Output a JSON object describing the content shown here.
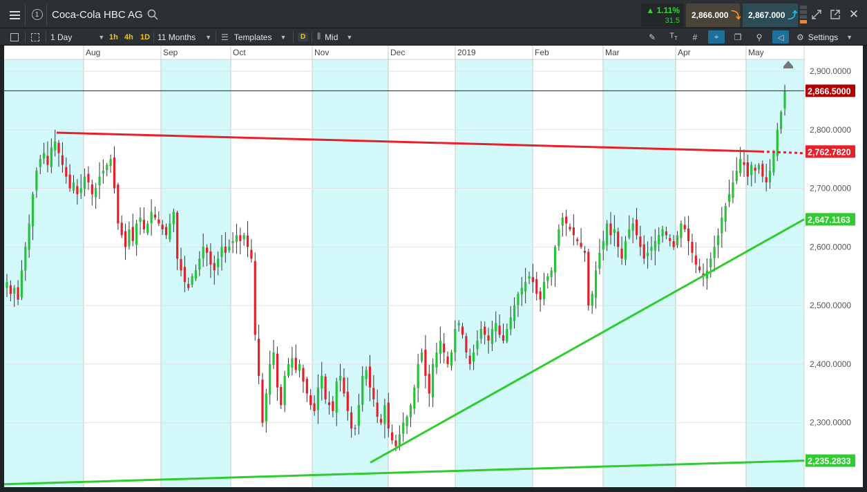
{
  "header": {
    "instrument_title": "Coca-Cola HBC AG",
    "change_pct": "▲ 1.11%",
    "change_abs": "31.5",
    "sell_price": "2,866.000",
    "buy_price": "2,867.000",
    "colors": {
      "up": "#38d13c",
      "sell_bg": "#4a4338",
      "buy_bg": "#2e4c58"
    }
  },
  "toolbar": {
    "interval_label": "1 Day",
    "quick_intervals": [
      "1h",
      "4h",
      "1D"
    ],
    "range_label": "11 Months",
    "templates_label": "Templates",
    "d_badge": "D",
    "price_type_label": "Mid",
    "settings_label": "Settings"
  },
  "chart_data": {
    "type": "candlestick",
    "x_months": [
      "Aug",
      "Sep",
      "Oct",
      "Nov",
      "Dec",
      "2019",
      "Feb",
      "Mar",
      "Apr",
      "May"
    ],
    "y_ticks": [
      "2,900.0000",
      "2,800.0000",
      "2,700.0000",
      "2,600.0000",
      "2,500.0000",
      "2,400.0000",
      "2,300.0000"
    ],
    "ylim": [
      2190,
      2920
    ],
    "current_price_label": "2,866.5000",
    "current_price": 2866.5,
    "price_labels": [
      {
        "text": "2,762.7820",
        "value": 2762.782,
        "color": "#e8202a",
        "kind": "resistance"
      },
      {
        "text": "2,647.1163",
        "value": 2647.1163,
        "color": "#2ecc2e",
        "kind": "support"
      },
      {
        "text": "2,235.2833",
        "value": 2235.2833,
        "color": "#2ecc2e",
        "kind": "support"
      }
    ],
    "colors": {
      "up": "#25c23a",
      "down": "#e3202a",
      "band": "#d4f9fb",
      "current": "#b30000"
    },
    "candles_ohlc_note": "daily candles Jul 2018 - May 2019",
    "closes": [
      2540,
      2520,
      2530,
      2510,
      2560,
      2600,
      2640,
      2690,
      2730,
      2750,
      2760,
      2740,
      2770,
      2780,
      2760,
      2740,
      2720,
      2700,
      2710,
      2690,
      2700,
      2720,
      2710,
      2690,
      2700,
      2720,
      2730,
      2740,
      2750,
      2700,
      2640,
      2620,
      2600,
      2630,
      2610,
      2640,
      2650,
      2630,
      2640,
      2660,
      2650,
      2640,
      2630,
      2620,
      2640,
      2660,
      2580,
      2560,
      2540,
      2530,
      2550,
      2560,
      2580,
      2600,
      2590,
      2570,
      2560,
      2580,
      2600,
      2590,
      2600,
      2610,
      2620,
      2610,
      2620,
      2600,
      2580,
      2450,
      2380,
      2300,
      2350,
      2400,
      2420,
      2360,
      2330,
      2380,
      2400,
      2410,
      2390,
      2400,
      2370,
      2350,
      2330,
      2320,
      2360,
      2380,
      2340,
      2330,
      2320,
      2370,
      2380,
      2350,
      2320,
      2290,
      2290,
      2330,
      2380,
      2390,
      2360,
      2340,
      2310,
      2300,
      2330,
      2290,
      2270,
      2260,
      2280,
      2300,
      2310,
      2330,
      2360,
      2400,
      2420,
      2380,
      2350,
      2400,
      2420,
      2440,
      2420,
      2400,
      2420,
      2460,
      2470,
      2450,
      2420,
      2400,
      2420,
      2440,
      2460,
      2450,
      2440,
      2460,
      2470,
      2450,
      2440,
      2460,
      2480,
      2500,
      2520,
      2530,
      2540,
      2550,
      2540,
      2520,
      2510,
      2540,
      2550,
      2560,
      2600,
      2630,
      2650,
      2640,
      2630,
      2620,
      2610,
      2600,
      2590,
      2500,
      2520,
      2560,
      2590,
      2610,
      2640,
      2620,
      2630,
      2600,
      2580,
      2610,
      2630,
      2640,
      2620,
      2600,
      2580,
      2590,
      2600,
      2610,
      2620,
      2630,
      2620,
      2610,
      2600,
      2620,
      2640,
      2630,
      2610,
      2590,
      2570,
      2560,
      2550,
      2560,
      2580,
      2600,
      2620,
      2650,
      2670,
      2690,
      2710,
      2730,
      2750,
      2740,
      2720,
      2740,
      2730,
      2740,
      2720,
      2710,
      2730,
      2760,
      2800,
      2830,
      2866
    ]
  }
}
